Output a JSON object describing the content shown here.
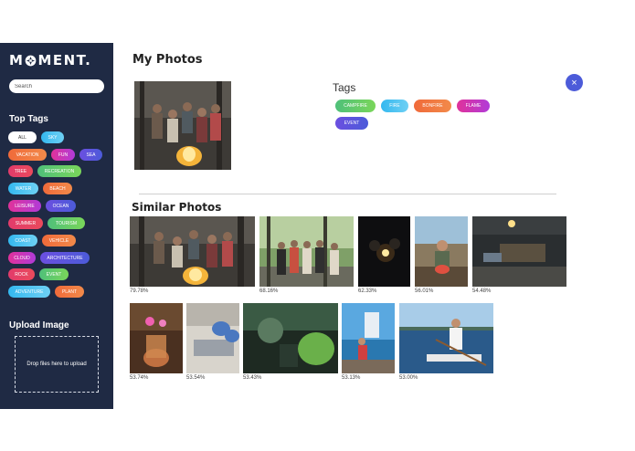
{
  "brand": {
    "logo_left": "M",
    "logo_right": "MENT."
  },
  "search": {
    "placeholder": "Search"
  },
  "sidebar": {
    "top_tags_title": "Top Tags",
    "tags": [
      [
        "All",
        "Sky"
      ],
      [
        "Vacation",
        "Fun",
        "Sea"
      ],
      [
        "Tree",
        "Recreation"
      ],
      [
        "Water",
        "Beach"
      ],
      [
        "Leisure",
        "Ocean"
      ],
      [
        "Summer",
        "Tourism"
      ],
      [
        "Coast",
        "Vehicle"
      ],
      [
        "Cloud",
        "Architecture"
      ],
      [
        "Rock",
        "Event"
      ],
      [
        "Adventure",
        "Plant"
      ]
    ],
    "upload_title": "Upload Image",
    "upload_hint": "Drop files here to upload"
  },
  "main": {
    "title": "My Photos",
    "close_icon": "×",
    "tags_title": "Tags",
    "photo_tags": [
      "Campfire",
      "Fire",
      "Bonfire",
      "Flame",
      "Event"
    ],
    "similar_title": "Similar Photos",
    "similar": [
      {
        "score": "79.78%"
      },
      {
        "score": "68.16%"
      },
      {
        "score": "62.33%"
      },
      {
        "score": "56.01%"
      },
      {
        "score": "54.48%"
      },
      {
        "score": "53.74%"
      },
      {
        "score": "53.54%"
      },
      {
        "score": "53.43%"
      },
      {
        "score": "53.13%"
      },
      {
        "score": "53.00%"
      }
    ]
  },
  "colors": {
    "sidebar_bg": "#1f2a44",
    "accent": "#4c5bd9"
  }
}
